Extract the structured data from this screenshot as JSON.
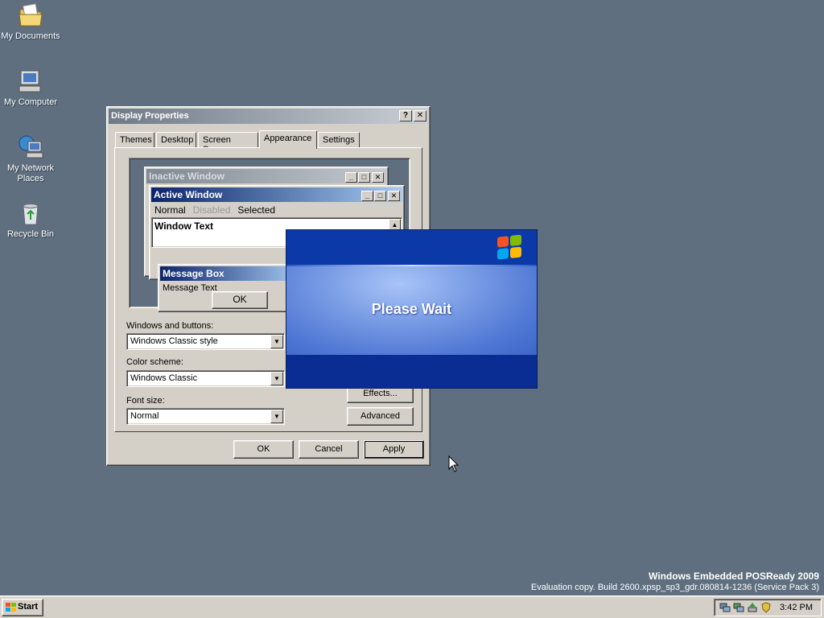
{
  "desktop": {
    "icons": [
      {
        "label": "My Documents",
        "icon": "my-documents-icon"
      },
      {
        "label": "My Computer",
        "icon": "my-computer-icon"
      },
      {
        "label": "My Network Places",
        "icon": "network-places-icon"
      },
      {
        "label": "Recycle Bin",
        "icon": "recycle-bin-icon"
      }
    ],
    "background_color": "#5f6f7f"
  },
  "dialog": {
    "title": "Display Properties",
    "help_button": "?",
    "close_button": "✕",
    "tabs": [
      {
        "label": "Themes",
        "active": false
      },
      {
        "label": "Desktop",
        "active": false
      },
      {
        "label": "Screen Saver",
        "active": false
      },
      {
        "label": "Appearance",
        "active": true
      },
      {
        "label": "Settings",
        "active": false
      }
    ],
    "preview": {
      "inactive_title": "Inactive Window",
      "active_title": "Active Window",
      "menu": {
        "normal": "Normal",
        "disabled": "Disabled",
        "selected": "Selected"
      },
      "window_text": "Window Text",
      "message_box_title": "Message Box",
      "message_text": "Message Text",
      "ok_label": "OK"
    },
    "fields": {
      "windows_buttons_label": "Windows and buttons:",
      "windows_buttons_value": "Windows Classic style",
      "color_scheme_label": "Color scheme:",
      "color_scheme_value": "Windows Classic",
      "font_size_label": "Font size:",
      "font_size_value": "Normal"
    },
    "effects_label": "Effects...",
    "advanced_label": "Advanced",
    "ok_label": "OK",
    "cancel_label": "Cancel",
    "apply_label": "Apply"
  },
  "splash": {
    "message": "Please Wait",
    "logo": "windows-flag-logo"
  },
  "watermark": {
    "line1": "Windows Embedded POSReady 2009",
    "line2": "Evaluation copy. Build 2600.xpsp_sp3_gdr.080814-1236 (Service Pack 3)"
  },
  "taskbar": {
    "start_label": "Start",
    "clock": "3:42 PM",
    "tray_icons": [
      "network-icon",
      "network-icon",
      "safely-remove-icon",
      "security-shield-icon"
    ]
  }
}
